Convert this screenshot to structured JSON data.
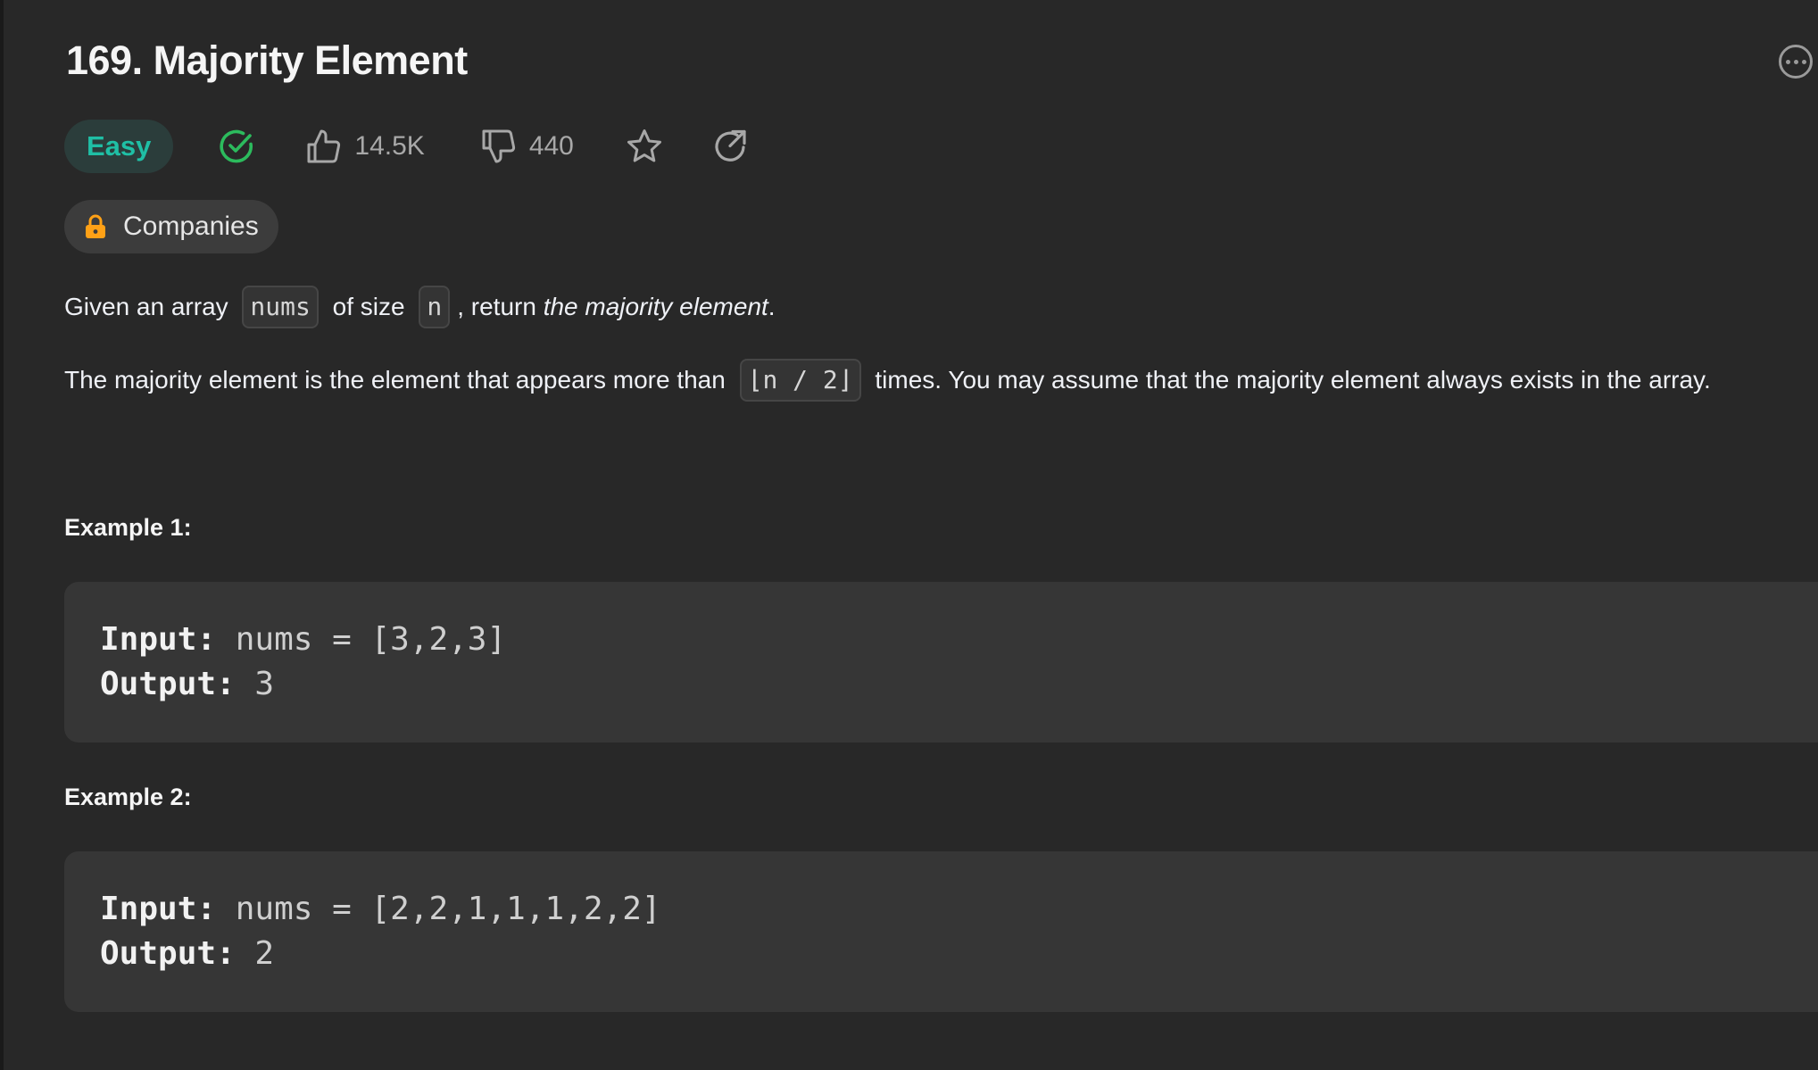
{
  "problem": {
    "title": "169. Majority Element",
    "difficulty": "Easy",
    "likes": "14.5K",
    "dislikes": "440",
    "companies_label": "Companies"
  },
  "description": {
    "p1": {
      "t1": "Given an array ",
      "code1": "nums",
      "t2": " of size ",
      "code2": "n",
      "t3": ", return ",
      "em": "the majority element",
      "t4": "."
    },
    "p2": {
      "t1": "The majority element is the element that appears more than ",
      "code1": "⌊n / 2⌋",
      "t2": " times. You may assume that the majority element always exists in the array."
    }
  },
  "examples": [
    {
      "title": "Example 1:",
      "input_label": "Input:",
      "input_value": " nums = [3,2,3]",
      "output_label": "Output:",
      "output_value": " 3"
    },
    {
      "title": "Example 2:",
      "input_label": "Input:",
      "input_value": " nums = [2,2,1,1,1,2,2]",
      "output_label": "Output:",
      "output_value": " 2"
    }
  ],
  "colors": {
    "background": "#282828",
    "easy": "#1fbfa5",
    "solved": "#2cbb5d",
    "lock": "#ffa116"
  },
  "icons": [
    "solved-check-icon",
    "thumbs-up-icon",
    "thumbs-down-icon",
    "star-icon",
    "share-icon",
    "lock-icon",
    "more-options-icon"
  ]
}
